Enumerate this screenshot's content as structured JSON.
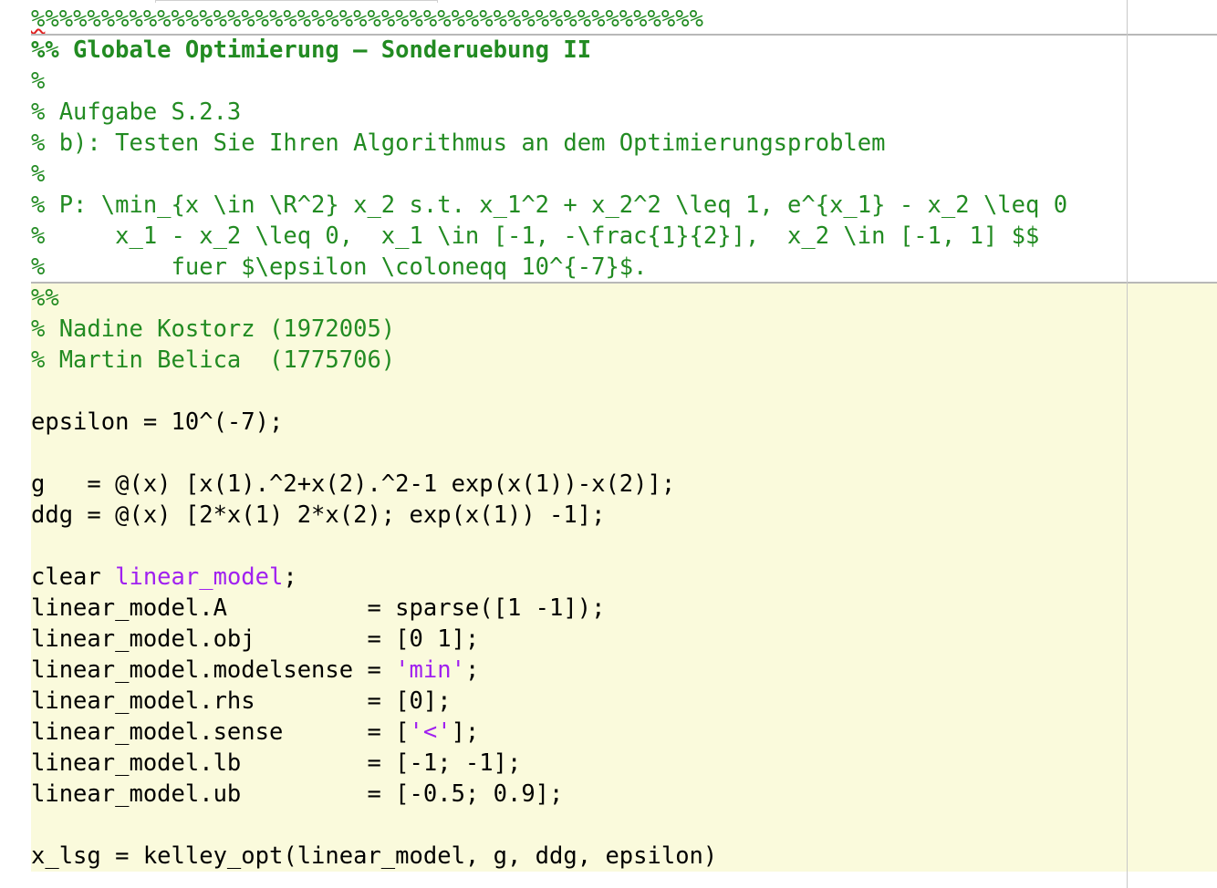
{
  "editor": {
    "lines": [
      {
        "cell": false,
        "segments": [
          {
            "type": "squiggle",
            "text": "%"
          },
          {
            "type": "comment",
            "text": "%%%%%%%%%%%%%%%%%%%%%%%%%%%%%%%%%%%%%%%%%%%%%%%"
          }
        ]
      },
      {
        "cell": false,
        "segments": [
          {
            "type": "comment-bold",
            "text": "%% Globale Optimierung – Sonderuebung II"
          }
        ]
      },
      {
        "cell": false,
        "segments": [
          {
            "type": "comment",
            "text": "%"
          }
        ]
      },
      {
        "cell": false,
        "segments": [
          {
            "type": "comment",
            "text": "% Aufgabe S.2.3"
          }
        ]
      },
      {
        "cell": false,
        "segments": [
          {
            "type": "comment",
            "text": "% b): Testen Sie Ihren Algorithmus an dem Optimierungsproblem"
          }
        ]
      },
      {
        "cell": false,
        "segments": [
          {
            "type": "comment",
            "text": "%"
          }
        ]
      },
      {
        "cell": false,
        "segments": [
          {
            "type": "comment",
            "text": "% P: \\min_{x \\in \\R^2} x_2 s.t. x_1^2 + x_2^2 \\leq 1, e^{x_1} - x_2 \\leq 0"
          }
        ]
      },
      {
        "cell": false,
        "segments": [
          {
            "type": "comment",
            "text": "%     x_1 - x_2 \\leq 0,  x_1 \\in [-1, -\\frac{1}{2}],  x_2 \\in [-1, 1] $$"
          }
        ]
      },
      {
        "cell": false,
        "segments": [
          {
            "type": "comment",
            "text": "%         fuer $\\epsilon \\coloneqq 10^{-7}$."
          }
        ]
      },
      {
        "cell": true,
        "segments": [
          {
            "type": "comment",
            "text": "%%"
          }
        ]
      },
      {
        "cell": true,
        "segments": [
          {
            "type": "comment",
            "text": "% Nadine Kostorz (1972005)"
          }
        ]
      },
      {
        "cell": true,
        "segments": [
          {
            "type": "comment",
            "text": "% Martin Belica  (1775706)"
          }
        ]
      },
      {
        "cell": true,
        "segments": []
      },
      {
        "cell": true,
        "segments": [
          {
            "type": "code",
            "text": "epsilon = 10^(-7);"
          }
        ]
      },
      {
        "cell": true,
        "segments": []
      },
      {
        "cell": true,
        "segments": [
          {
            "type": "code",
            "text": "g   = @(x) [x(1).^2+x(2).^2-1 exp(x(1))-x(2)];"
          }
        ]
      },
      {
        "cell": true,
        "segments": [
          {
            "type": "code",
            "text": "ddg = @(x) [2*x(1) 2*x(2); exp(x(1)) -1];"
          }
        ]
      },
      {
        "cell": true,
        "segments": []
      },
      {
        "cell": true,
        "segments": [
          {
            "type": "code",
            "text": "clear "
          },
          {
            "type": "string",
            "text": "linear_model"
          },
          {
            "type": "code",
            "text": ";"
          }
        ]
      },
      {
        "cell": true,
        "segments": [
          {
            "type": "code",
            "text": "linear_model.A          = sparse([1 -1]);"
          }
        ]
      },
      {
        "cell": true,
        "segments": [
          {
            "type": "code",
            "text": "linear_model.obj        = [0 1];"
          }
        ]
      },
      {
        "cell": true,
        "segments": [
          {
            "type": "code",
            "text": "linear_model.modelsense = "
          },
          {
            "type": "string",
            "text": "'min'"
          },
          {
            "type": "code",
            "text": ";"
          }
        ]
      },
      {
        "cell": true,
        "segments": [
          {
            "type": "code",
            "text": "linear_model.rhs        = [0];"
          }
        ]
      },
      {
        "cell": true,
        "segments": [
          {
            "type": "code",
            "text": "linear_model.sense      = ["
          },
          {
            "type": "string",
            "text": "'<'"
          },
          {
            "type": "code",
            "text": "];"
          }
        ]
      },
      {
        "cell": true,
        "segments": [
          {
            "type": "code",
            "text": "linear_model.lb         = [-1; -1];"
          }
        ]
      },
      {
        "cell": true,
        "segments": [
          {
            "type": "code",
            "text": "linear_model.ub         = [-0.5; 0.9];"
          }
        ]
      },
      {
        "cell": true,
        "segments": []
      },
      {
        "cell": true,
        "segments": [
          {
            "type": "code",
            "text": "x_lsg = kelley_opt(linear_model, g, ddg, epsilon)"
          }
        ]
      }
    ]
  },
  "colors": {
    "comment": "#228b22",
    "string": "#a020f0",
    "code": "#000000",
    "cell_background": "#fafadc",
    "squiggle": "#e02020"
  }
}
